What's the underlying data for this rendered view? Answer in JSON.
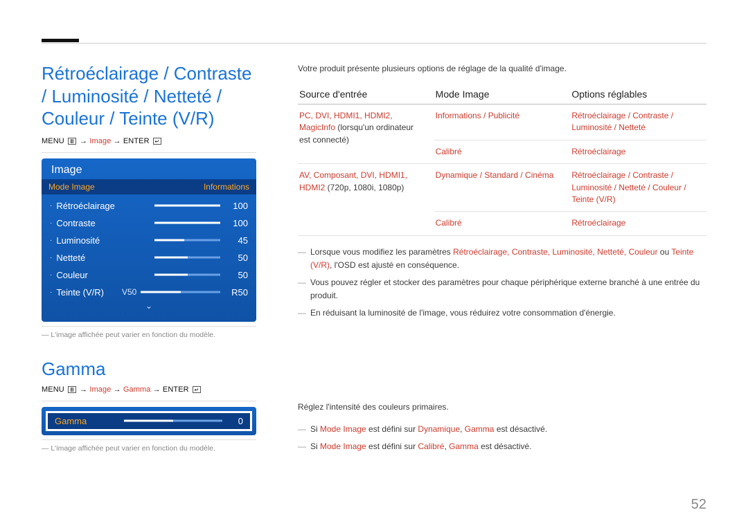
{
  "page_number": "52",
  "heading1": "Rétroéclairage / Contraste / Luminosité / Netteté / Couleur / Teinte (V/R)",
  "menupath1": {
    "prefix": "MENU",
    "seg1": "Image",
    "seg2": "ENTER"
  },
  "osd": {
    "title": "Image",
    "tab_left": "Mode Image",
    "tab_right": "Informations",
    "rows": [
      {
        "label": "Rétroéclairage",
        "value": "100",
        "fill_pct": 100
      },
      {
        "label": "Contraste",
        "value": "100",
        "fill_pct": 100
      },
      {
        "label": "Luminosité",
        "value": "45",
        "fill_pct": 45
      },
      {
        "label": "Netteté",
        "value": "50",
        "fill_pct": 50
      },
      {
        "label": "Couleur",
        "value": "50",
        "fill_pct": 50
      }
    ],
    "tint_row": {
      "label": "Teinte (V/R)",
      "left": "V50",
      "right": "R50",
      "fill_pct": 50
    }
  },
  "note_model": "L'image affichée peut varier en fonction du modèle.",
  "heading2": "Gamma",
  "menupath2": {
    "prefix": "MENU",
    "seg1": "Image",
    "seg2": "Gamma",
    "seg3": "ENTER"
  },
  "gamma": {
    "label": "Gamma",
    "value": "0"
  },
  "right": {
    "intro": "Votre produit présente plusieurs options de réglage de la qualité d'image.",
    "th1": "Source d'entrée",
    "th2": "Mode Image",
    "th3": "Options réglables",
    "row1": {
      "c1_red": "PC, DVI, HDMI1, HDMI2, MagicInfo",
      "c1_plain": " (lorsqu'un ordinateur est connecté)",
      "c2": "Informations / Publicité",
      "c3": "Rétroéclairage / Contraste / Luminosité / Netteté"
    },
    "row2": {
      "c2": "Calibré",
      "c3": "Rétroéclairage"
    },
    "row3": {
      "c1_red": "AV, Composant, DVI, HDMI1, HDMI2",
      "c1_plain": " (720p, 1080i, 1080p)",
      "c2": "Dynamique / Standard / Cinéma",
      "c3": "Rétroéclairage / Contraste / Luminosité / Netteté / Couleur / Teinte (V/R)"
    },
    "row4": {
      "c2": "Calibré",
      "c3": "Rétroéclairage"
    },
    "bullets1": {
      "b1_pre": "Lorsque vous modifiez les paramètres ",
      "b1_list": "Rétroéclairage, Contraste, Luminosité, Netteté, Couleur",
      "b1_or": " ou ",
      "b1_last": "Teinte (V/R)",
      "b1_post": ", l'OSD est ajusté en conséquence.",
      "b2": "Vous pouvez régler et stocker des paramètres pour chaque périphérique externe branché à une entrée du produit.",
      "b3": "En réduisant la luminosité de l'image, vous réduirez votre consommation d'énergie."
    },
    "gamma_intro": "Réglez l'intensité des couleurs primaires.",
    "gamma_b1_pre": "Si ",
    "gamma_b1_m": "Mode Image",
    "gamma_b1_mid": " est défini sur ",
    "gamma_b1_dyn": "Dynamique",
    "gamma_b1_c": ", ",
    "gamma_b1_g": "Gamma",
    "gamma_b1_post": " est désactivé.",
    "gamma_b2_cal": "Calibré"
  }
}
